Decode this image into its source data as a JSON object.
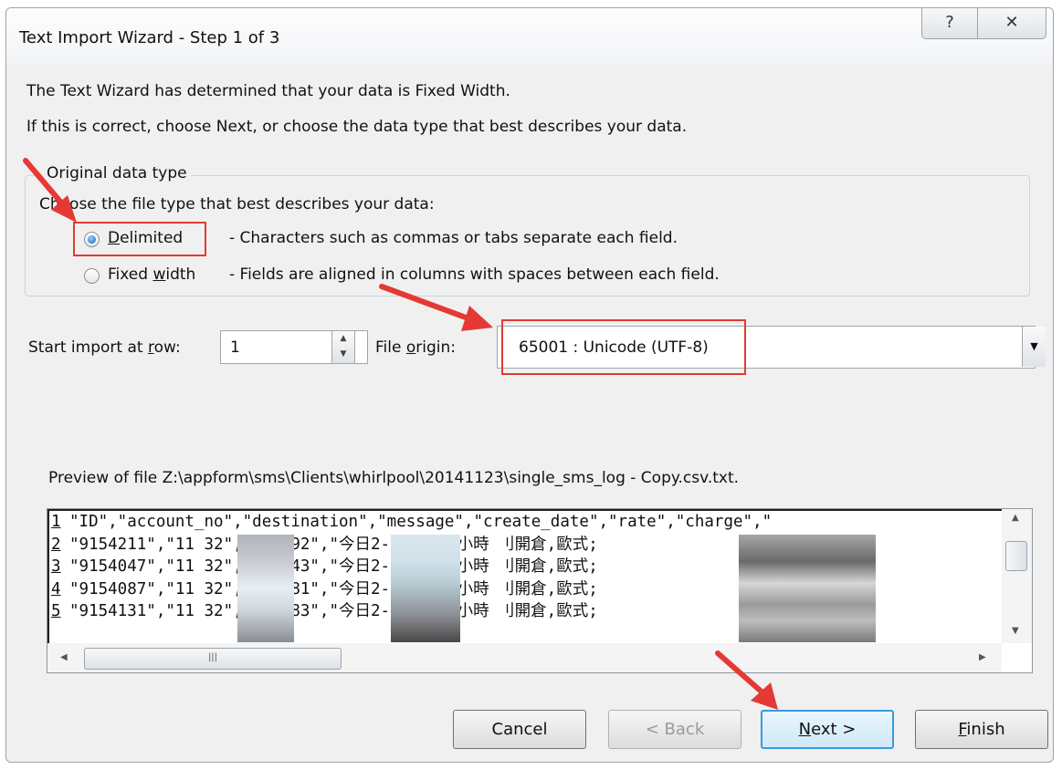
{
  "window": {
    "title": "Text Import Wizard - Step 1 of 3",
    "help_glyph": "?",
    "close_glyph": "✕"
  },
  "intro": {
    "line1": "The Text Wizard has determined that your data is Fixed Width.",
    "line2": "If this is correct, choose Next, or choose the data type that best describes your data."
  },
  "data_type": {
    "legend": "Original data type",
    "prompt": "Choose the file type that best describes your data:",
    "options": [
      {
        "label": "Delimited",
        "accel": "D",
        "rest": "elimited",
        "description": "- Characters such as commas or tabs separate each field.",
        "selected": true
      },
      {
        "label": "Fixed width",
        "pre": "Fixed ",
        "accel": "w",
        "rest": "idth",
        "description": "- Fields are aligned in columns with spaces between each field.",
        "selected": false
      }
    ]
  },
  "start_row": {
    "label_pre": "Start import at ",
    "accel": "r",
    "label_post": "ow:",
    "value": "1"
  },
  "file_origin": {
    "label_pre": "File ",
    "accel": "o",
    "label_post": "rigin:",
    "value": "65001 : Unicode (UTF-8)"
  },
  "preview": {
    "label": "Preview of file Z:\\appform\\sms\\Clients\\whirlpool\\20141123\\single_sms_log - Copy.csv.txt.",
    "rows": [
      {
        "num": "1",
        "text": "\"ID\",\"account_no\",\"destination\",\"message\",\"create_date\",\"rate\",\"charge\",\""
      },
      {
        "num": "2",
        "text": "\"9154211\",\"11    32\",\"85:      92\",\"今日2-6點最後4小時              刂開倉,歐式;"
      },
      {
        "num": "3",
        "text": "\"9154047\",\"11    32\",\"85:      43\",\"今日2-6點最後4小時              刂開倉,歐式;"
      },
      {
        "num": "4",
        "text": "\"9154087\",\"11    32\",\"85:      81\",\"今日2-6點最後4小時              刂開倉,歐式;"
      },
      {
        "num": "5",
        "text": "\"9154131\",\"11    32\",\"85:      83\",\"今日2-6點最後4小時              刂開倉,歐式;"
      }
    ]
  },
  "buttons": {
    "cancel": "Cancel",
    "back": "< Back",
    "next_accel": "N",
    "next_rest": "ext >",
    "finish_accel": "F",
    "finish_rest": "inish"
  },
  "colors": {
    "annotation": "#e53935",
    "default_button_border": "#3c9ad8"
  }
}
